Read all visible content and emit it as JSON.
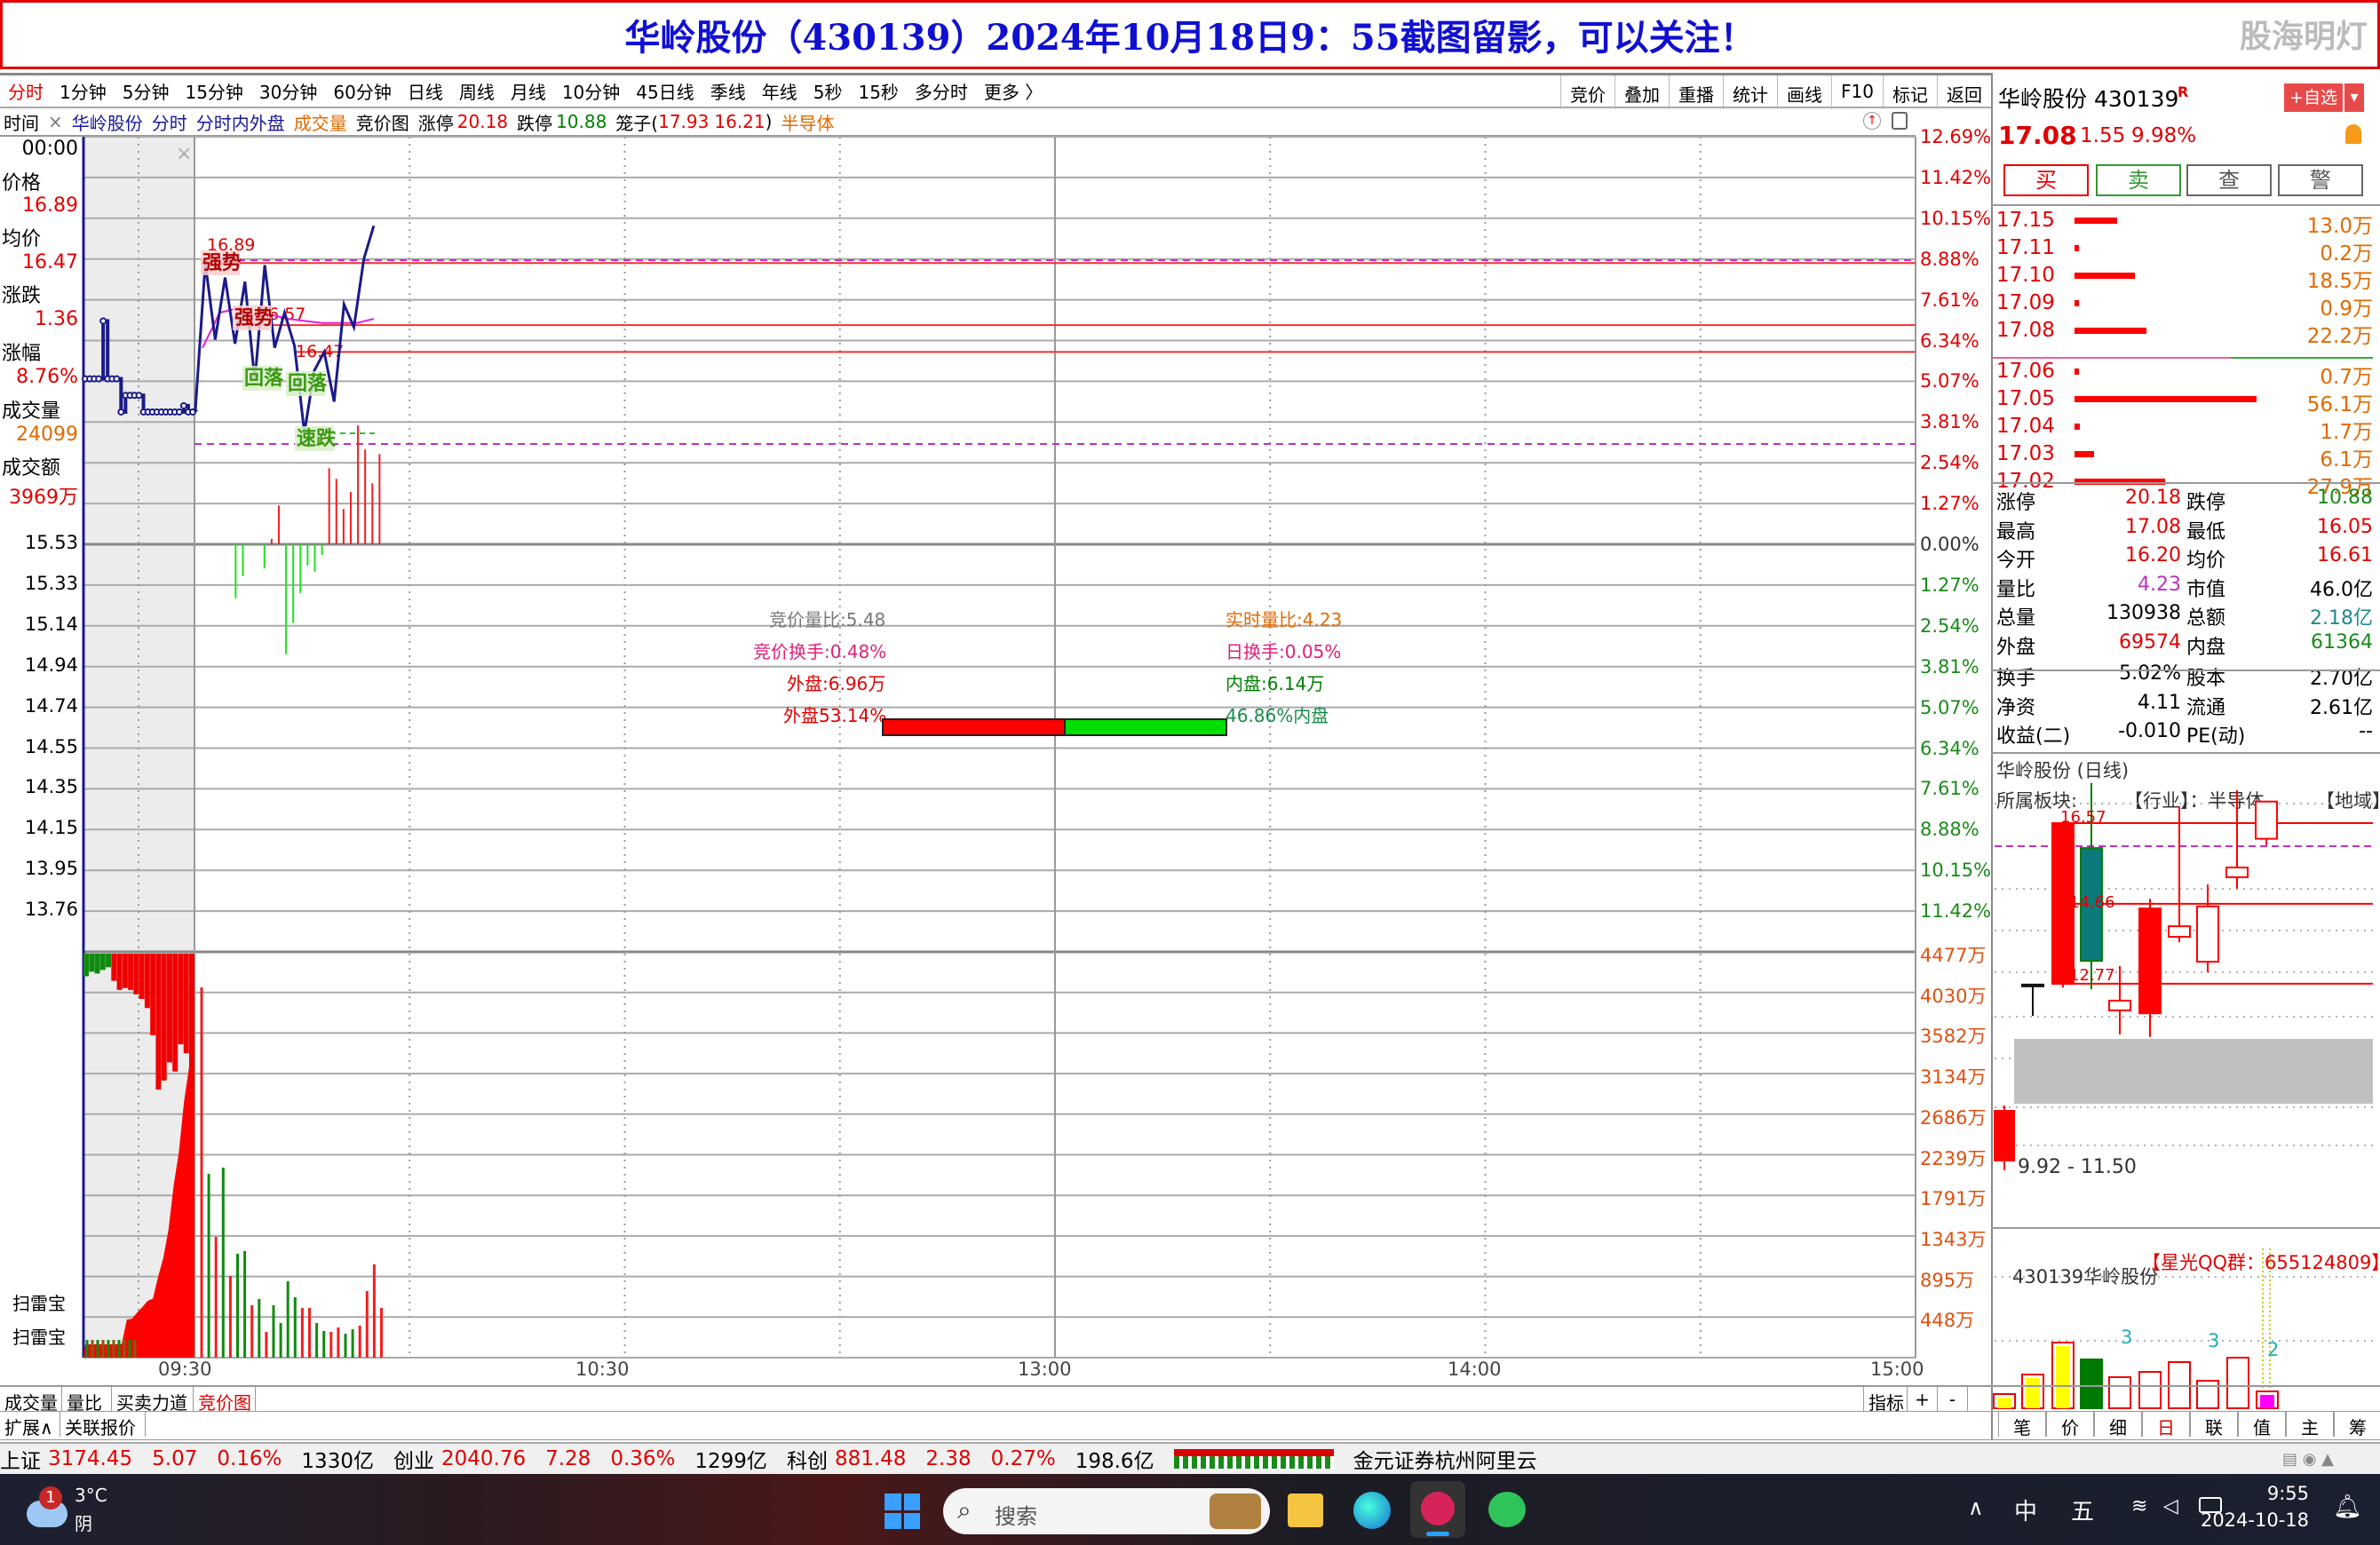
{
  "title": "华岭股份（430139）2024年10月18日9：55截图留影，可以关注！",
  "watermark": "股海明灯",
  "menu": {
    "periods": [
      "分时",
      "1分钟",
      "5分钟",
      "15分钟",
      "30分钟",
      "60分钟",
      "日线",
      "周线",
      "月线",
      "10分钟",
      "45日线",
      "季线",
      "年线",
      "5秒",
      "15秒",
      "多分时",
      "更多 〉"
    ],
    "active": "分时",
    "tools": [
      "竞价",
      "叠加",
      "重播",
      "统计",
      "画线",
      "F10",
      "标记",
      "返回"
    ]
  },
  "infobar": {
    "time_label": "时间",
    "close": "×",
    "name": "华岭股份",
    "t1": "分时",
    "t2": "分时内外盘",
    "t3": "成交量",
    "t4": "竞价图",
    "limit_up_label": "涨停",
    "limit_up": "20.18",
    "limit_down_label": "跌停",
    "limit_down": "10.88",
    "cage": "笼子(",
    "cage_hi": "17.93",
    "cage_lo": "16.21",
    "cage_end": ")",
    "sector": "半导体"
  },
  "left_info": {
    "time": "00:00",
    "price_label": "价格",
    "price": "16.89",
    "avg_label": "均价",
    "avg": "16.47",
    "chg_label": "涨跌",
    "chg": "1.36",
    "pct_label": "涨幅",
    "pct": "8.76%",
    "vol_label": "成交量",
    "vol": "24099",
    "amt_label": "成交额",
    "amt": "3969万",
    "saoleibao": [
      "扫雷宝",
      "扫雷宝"
    ]
  },
  "chart_data": {
    "type": "line",
    "prev_close": 15.53,
    "price_axis_left": [
      "15.53",
      "15.33",
      "15.14",
      "14.94",
      "14.74",
      "14.55",
      "14.35",
      "14.15",
      "13.95",
      "13.76"
    ],
    "pct_axis_up": [
      "12.69%",
      "11.42%",
      "10.15%",
      "8.88%",
      "7.61%",
      "6.34%",
      "5.07%",
      "3.81%",
      "2.54%",
      "1.27%",
      "0.00%"
    ],
    "pct_axis_down": [
      "1.27%",
      "2.54%",
      "3.81%",
      "5.07%",
      "6.34%",
      "7.61%",
      "8.88%",
      "10.15%",
      "11.42%"
    ],
    "volume_axis": [
      "4477万",
      "4030万",
      "3582万",
      "3134万",
      "2686万",
      "2239万",
      "1791万",
      "1343万",
      "895万",
      "448万"
    ],
    "volume_max": 4477,
    "time_labels": [
      "09:30",
      "10:30",
      "13:00",
      "14:00",
      "15:00"
    ],
    "auction_price": [
      16.33,
      16.33,
      16.33,
      16.33,
      16.61,
      16.33,
      16.33,
      16.33,
      16.17,
      16.25,
      16.25,
      16.25,
      16.25,
      16.17,
      16.17,
      16.17,
      16.17,
      16.17,
      16.17,
      16.17,
      16.17,
      16.17,
      16.2,
      16.17,
      16.17
    ],
    "price_line": [
      16.18,
      16.89,
      16.52,
      16.82,
      16.5,
      16.8,
      16.32,
      16.88,
      16.48,
      16.65,
      16.49,
      16.07,
      16.37,
      16.46,
      16.22,
      16.69,
      16.58,
      16.91,
      17.07
    ],
    "price_line_span": [
      "09:30",
      "09:55"
    ],
    "avg_line": [
      16.48,
      16.65,
      16.67,
      16.64,
      16.64,
      16.62,
      16.61,
      16.6,
      16.6,
      16.6,
      16.62
    ],
    "avg_line_span": [
      "09:31",
      "09:55"
    ],
    "levels": [
      {
        "label": "16.89",
        "price": 16.89
      },
      {
        "label": "16.57",
        "price": 16.59
      },
      {
        "label": "16.47",
        "price": 16.46
      }
    ],
    "signals": [
      {
        "text": "强势",
        "kind": "up"
      },
      {
        "text": "强势",
        "kind": "up"
      },
      {
        "text": "回落",
        "kind": "down"
      },
      {
        "text": "回落",
        "kind": "down"
      },
      {
        "text": "速跌",
        "kind": "down"
      }
    ],
    "auction_bars_pct": [
      -1.68,
      -0.99,
      -0.03,
      -0.03,
      -0.75,
      0.17,
      1.21,
      -3.42,
      -2.45,
      -1.52,
      -0.66,
      -0.85,
      -0.33,
      2.37,
      2.04,
      1.1,
      1.63,
      3.7,
      2.95,
      1.9,
      2.81
    ],
    "auction_bars_start": "09:35",
    "volume": [
      {
        "v": 4085,
        "c": "r"
      },
      {
        "v": 2028,
        "c": "g"
      },
      {
        "v": 1332,
        "c": "r"
      },
      {
        "v": 2096,
        "c": "g"
      },
      {
        "v": 901,
        "c": "r"
      },
      {
        "v": 1146,
        "c": "g"
      },
      {
        "v": 1175,
        "c": "g"
      },
      {
        "v": 578,
        "c": "r"
      },
      {
        "v": 646,
        "c": "g"
      },
      {
        "v": 284,
        "c": "r"
      },
      {
        "v": 578,
        "c": "g"
      },
      {
        "v": 382,
        "c": "g"
      },
      {
        "v": 842,
        "c": "g"
      },
      {
        "v": 666,
        "c": "g"
      },
      {
        "v": 549,
        "c": "r"
      },
      {
        "v": 549,
        "c": "r"
      },
      {
        "v": 382,
        "c": "g"
      },
      {
        "v": 294,
        "c": "g"
      },
      {
        "v": 284,
        "c": "r"
      },
      {
        "v": 333,
        "c": "r"
      },
      {
        "v": 264,
        "c": "g"
      },
      {
        "v": 313,
        "c": "g"
      },
      {
        "v": 353,
        "c": "r"
      },
      {
        "v": 735,
        "c": "r"
      },
      {
        "v": 1029,
        "c": "r"
      },
      {
        "v": 549,
        "c": "r"
      }
    ],
    "auction_matched_volume": [
      147,
      147,
      147,
      147,
      147,
      147,
      147,
      150,
      420,
      430,
      500,
      560,
      627,
      650,
      890,
      1100,
      1410,
      1900,
      2270,
      2830,
      3220,
      3300
    ],
    "auction_unmatched_volume": [
      250,
      200,
      220,
      180,
      150,
      300,
      400,
      380,
      400,
      450,
      500,
      600,
      900,
      1500,
      1400,
      1200,
      1300,
      1000,
      1100,
      1500
    ]
  },
  "auction_stats": {
    "ratio": "竞价量比:5.48",
    "turnover": "竞价换手:0.48%",
    "outer": "外盘:6.96万",
    "outer_pct": "外盘53.14%",
    "rt_ratio": "实时量比:4.23",
    "day_turnover": "日换手:0.05%",
    "inner": "内盘:6.14万",
    "inner_pct": "46.86%内盘",
    "outer_share": 53.14
  },
  "quote": {
    "name": "华岭股份 430139",
    "badge": "R",
    "add_watch": "+自选",
    "dropdown": "▾",
    "price": "17.08",
    "change": "1.55",
    "pct": "9.98%",
    "buttons": [
      "买",
      "卖",
      "查",
      "警"
    ],
    "asks": [
      {
        "p": "17.15",
        "v": "13.0万",
        "n": 13.0
      },
      {
        "p": "17.11",
        "v": "0.2万",
        "n": 0.2
      },
      {
        "p": "17.10",
        "v": "18.5万",
        "n": 18.5
      },
      {
        "p": "17.09",
        "v": "0.9万",
        "n": 0.9
      },
      {
        "p": "17.08",
        "v": "22.2万",
        "n": 22.2
      }
    ],
    "bids": [
      {
        "p": "17.06",
        "v": "0.7万",
        "n": 0.7
      },
      {
        "p": "17.05",
        "v": "56.1万",
        "n": 56.1
      },
      {
        "p": "17.04",
        "v": "1.7万",
        "n": 1.7
      },
      {
        "p": "17.03",
        "v": "6.1万",
        "n": 6.1
      },
      {
        "p": "17.02",
        "v": "27.9万",
        "n": 27.9
      }
    ],
    "stats": [
      [
        "涨停",
        "20.18",
        "跌停",
        "10.88",
        "red",
        "green"
      ],
      [
        "最高",
        "17.08",
        "最低",
        "16.05",
        "red",
        "red"
      ],
      [
        "今开",
        "16.20",
        "均价",
        "16.61",
        "red",
        "red"
      ],
      [
        "量比",
        "4.23",
        "市值",
        "46.0亿",
        "purple",
        ""
      ],
      [
        "总量",
        "130938",
        "总额",
        "2.18亿",
        "",
        "teal"
      ],
      [
        "外盘",
        "69574",
        "内盘",
        "61364",
        "red",
        "green"
      ]
    ],
    "stats2": [
      [
        "换手",
        "5.02%",
        "股本",
        "2.70亿"
      ],
      [
        "净资",
        "4.11",
        "流通",
        "2.61亿"
      ],
      [
        "收益(二)",
        "-0.010",
        "PE(动)",
        "--"
      ]
    ]
  },
  "daily": {
    "title": "华岭股份 (日线)",
    "sector_label": "所属板块:",
    "industry": "【行业】：半导体",
    "region": "【地域】",
    "hi_label": "16.57",
    "mid_label": "14.66",
    "lo_label": "12.77",
    "range_label": "9.92 - 11.50",
    "qq": "【星光QQ群：655124809】",
    "overlay": "430139华岭股份",
    "candles": [
      {
        "o": 12.75,
        "h": 12.75,
        "l": 12.01,
        "c": 12.75
      },
      {
        "o": 12.77,
        "h": 16.57,
        "l": 12.68,
        "c": 16.57
      },
      {
        "o": 15.98,
        "h": 17.52,
        "l": 12.64,
        "c": 13.31
      },
      {
        "o": 12.14,
        "h": 13.19,
        "l": 11.57,
        "c": 12.37
      },
      {
        "o": 12.07,
        "h": 14.78,
        "l": 11.51,
        "c": 14.55
      },
      {
        "o": 13.88,
        "h": 16.97,
        "l": 13.75,
        "c": 14.13
      },
      {
        "o": 13.29,
        "h": 15.12,
        "l": 13.04,
        "c": 14.6
      },
      {
        "o": 15.29,
        "h": 17.35,
        "l": 15.02,
        "c": 15.52
      },
      {
        "o": 16.2,
        "h": 17.08,
        "l": 16.05,
        "c": 17.08
      }
    ],
    "vol_bars": [
      16,
      38,
      74,
      55,
      35,
      41,
      52,
      31,
      57,
      19
    ],
    "vol_bar_fill": [
      "#ffff00",
      "#ffff00",
      "#ffff00",
      "#007a00",
      "",
      "",
      "",
      "",
      "",
      "#ff00ff"
    ],
    "vol_marks": [
      "3",
      "3",
      "2"
    ]
  },
  "bottom": {
    "tabs": [
      "成交量",
      "量比",
      "买卖力道",
      "竞价图"
    ],
    "tabs2": [
      "扩展∧",
      "关联报价"
    ],
    "indicator": "指标",
    "plus": "+",
    "minus": "-",
    "rtabs": [
      "笔",
      "价",
      "细",
      "日",
      "联",
      "值",
      "主",
      "筹"
    ]
  },
  "indices": [
    {
      "name": "上证",
      "v": "3174.45",
      "c": "5.07",
      "p": "0.16%",
      "a": "1330亿"
    },
    {
      "name": "创业",
      "v": "2040.76",
      "c": "7.28",
      "p": "0.36%",
      "a": "1299亿"
    },
    {
      "name": "科创",
      "v": "881.48",
      "c": "2.38",
      "p": "0.27%",
      "a": "198.6亿"
    }
  ],
  "broker": "金元证券杭州阿里云",
  "taskbar": {
    "weather_badge": "1",
    "temp": "3°C",
    "weather": "阴",
    "search": "搜索",
    "ime1": "中",
    "ime2": "五",
    "time": "9:55",
    "date": "2024-10-18"
  },
  "colors": {
    "up": "#e00000",
    "down": "#008000",
    "price_line": "#1a1a8a",
    "avg_line": "#e020e0",
    "title": "#1010d0"
  }
}
